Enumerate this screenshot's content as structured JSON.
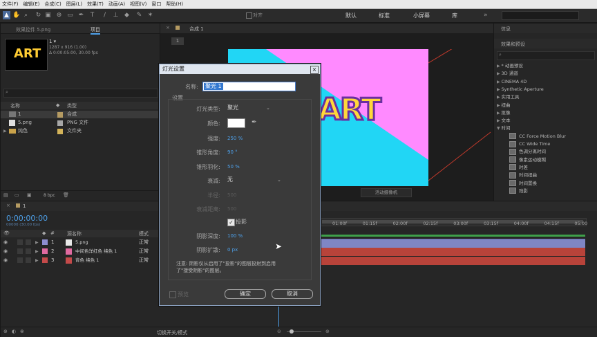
{
  "menu": [
    "文件(F)",
    "编辑(E)",
    "合成(C)",
    "图层(L)",
    "效果(T)",
    "动画(A)",
    "视图(V)",
    "窗口",
    "帮助(H)"
  ],
  "toolbar": {
    "align_label": "对齐",
    "workspaces": [
      "默认",
      "标准",
      "小屏幕",
      "库"
    ]
  },
  "project": {
    "tab_label": "效果控件 5.png",
    "tab2": "项目",
    "item_name": "1 ▾",
    "item_info1": "1287 x 916 (1.00)",
    "item_info2": "Δ 0:00:05:00, 30.00 fps",
    "thumb_text": "ART",
    "col_name": "名称",
    "col_type": "类型",
    "items": [
      {
        "name": "1",
        "type": "合成",
        "color": "#b59b62"
      },
      {
        "name": "5.png",
        "type": "PNG 文件",
        "color": "#a7a7a7"
      },
      {
        "name": "纯色",
        "type": "文件夹",
        "color": "#d3b35a"
      }
    ],
    "bpc": "8 bpc"
  },
  "comp": {
    "tab_label": "合成 1",
    "sub_tab": "1",
    "art_text": "ART",
    "camera_label": "活动摄像机"
  },
  "effects": {
    "tab1": "信息",
    "tab2": "效果和预设",
    "items": [
      {
        "label": "* 动画预设",
        "indent": 0,
        "icon": false
      },
      {
        "label": "3D 通道",
        "indent": 0,
        "icon": false
      },
      {
        "label": "CINEMA 4D",
        "indent": 0,
        "icon": false
      },
      {
        "label": "Synthetic Aperture",
        "indent": 0,
        "icon": false
      },
      {
        "label": "实用工具",
        "indent": 0,
        "icon": false
      },
      {
        "label": "扭曲",
        "indent": 0,
        "icon": false
      },
      {
        "label": "抠像",
        "indent": 0,
        "icon": false
      },
      {
        "label": "文本",
        "indent": 0,
        "icon": false
      },
      {
        "label": "时间",
        "indent": 0,
        "icon": false,
        "open": true
      },
      {
        "label": "CC Force Motion Blur",
        "indent": 1,
        "icon": true
      },
      {
        "label": "CC Wide Time",
        "indent": 1,
        "icon": true
      },
      {
        "label": "色调分离时间",
        "indent": 1,
        "icon": true
      },
      {
        "label": "像素运动模糊",
        "indent": 1,
        "icon": true
      },
      {
        "label": "时差",
        "indent": 1,
        "icon": true
      },
      {
        "label": "时间扭曲",
        "indent": 1,
        "icon": true
      },
      {
        "label": "时间置换",
        "indent": 1,
        "icon": true
      },
      {
        "label": "残影",
        "indent": 1,
        "icon": true
      }
    ]
  },
  "timeline": {
    "tab_label": "1",
    "timecode": "0:00:00:00",
    "fps_sub": "00000 (30.00 fps)",
    "col_source": "源名称",
    "col_mode": "模式",
    "layers": [
      {
        "num": "1",
        "name": "5.png",
        "mode": "正常",
        "color": "#8e8ed0"
      },
      {
        "num": "2",
        "name": "中间色洋红色 纯色 1",
        "mode": "正常",
        "color": "#e06aa0"
      },
      {
        "num": "3",
        "name": "背色 纯色 1",
        "mode": "正常",
        "color": "#c44a4a"
      }
    ],
    "ruler": [
      "01:00f",
      "01:15f",
      "02:00f",
      "02:15f",
      "03:00f",
      "03:15f",
      "04:00f",
      "04:15f",
      "05:00"
    ],
    "toggle_label": "切换开关/模式"
  },
  "dialog": {
    "title": "灯光设置",
    "name_label": "名称:",
    "name_value": "聚光 1",
    "settings_label": "设置",
    "light_type_label": "灯光类型:",
    "light_type_value": "聚光",
    "color_label": "颜色:",
    "intensity_label": "强度:",
    "intensity_value": "250 %",
    "cone_angle_label": "锥形角度:",
    "cone_angle_value": "90 °",
    "cone_feather_label": "锥形羽化:",
    "cone_feather_value": "50 %",
    "falloff_label": "衰减:",
    "falloff_value": "无",
    "radius_label": "半径:",
    "radius_value": "500",
    "falloff_dist_label": "衰减距离:",
    "falloff_dist_value": "500",
    "shadow_label": "投影",
    "shadow_darkness_label": "阴影深度:",
    "shadow_darkness_value": "100 %",
    "shadow_diffusion_label": "阴影扩散:",
    "shadow_diffusion_value": "0 px",
    "note_line1": "注意: 阴影仅从启用了\"投影\"的图层投射到启用",
    "note_line2": "了\"接受阴影\"的图层。",
    "preview_label": "预览",
    "ok_label": "确定",
    "cancel_label": "取消"
  },
  "colors": {
    "accent": "#4ea1ea",
    "magenta_bg": "#ff8aff",
    "cyan_bg": "#21d6f5"
  }
}
